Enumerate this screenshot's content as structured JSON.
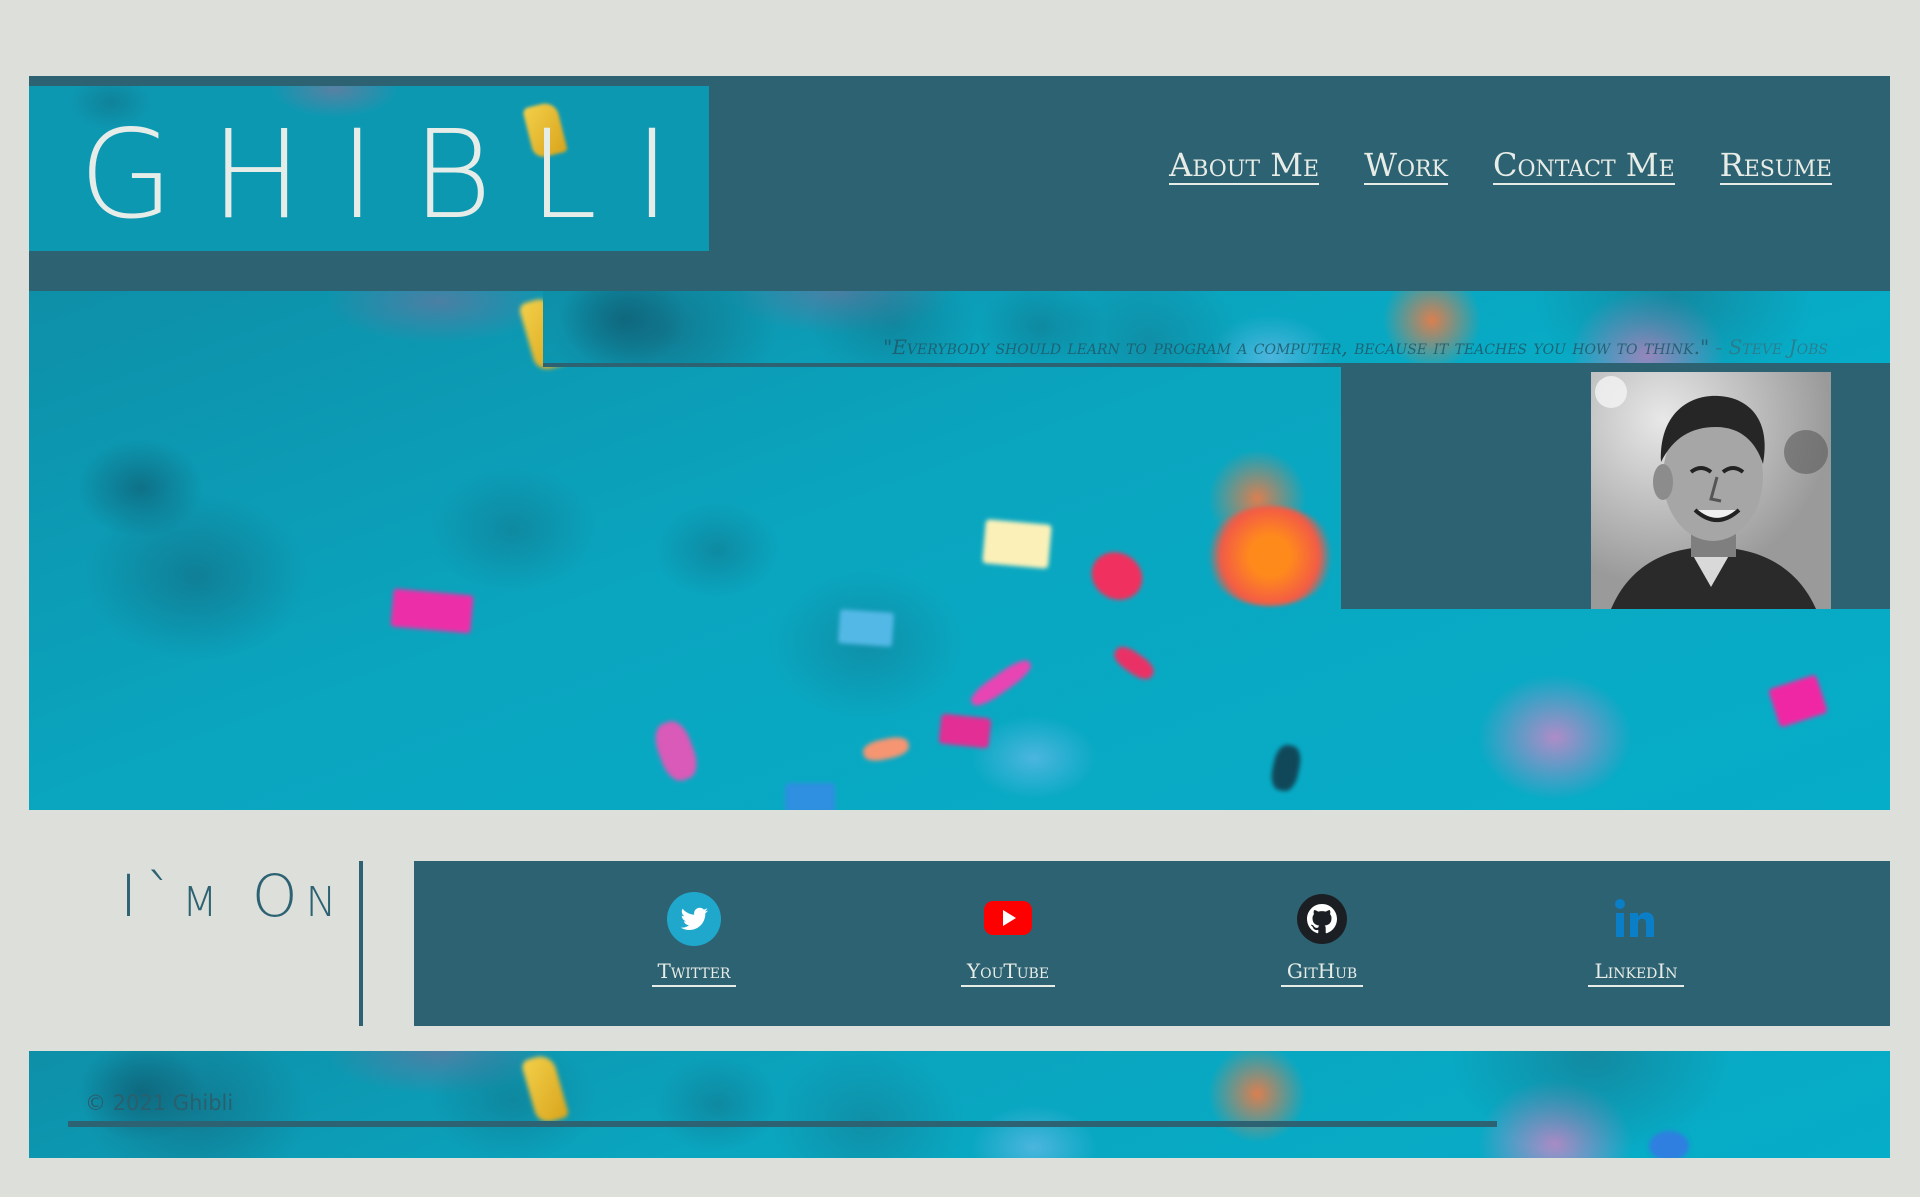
{
  "site": {
    "logo": "GHIBLI"
  },
  "nav": {
    "items": [
      {
        "label": "About Me"
      },
      {
        "label": "Work"
      },
      {
        "label": "Contact Me"
      },
      {
        "label": "Resume"
      }
    ]
  },
  "hero": {
    "quote": "\"Everybody should learn to program a computer, because it teaches you how to think.\"",
    "quote_author": " - Steve Jobs"
  },
  "social": {
    "heading": "I`m On",
    "items": [
      {
        "label": "Twitter",
        "icon": "twitter-icon",
        "color": "#1da1f2"
      },
      {
        "label": "YouTube",
        "icon": "youtube-icon",
        "color": "#ff0000"
      },
      {
        "label": "GitHub",
        "icon": "github-icon",
        "color": "#1b1f23"
      },
      {
        "label": "LinkedIn",
        "icon": "linkedin-icon",
        "color": "#0a66c2"
      }
    ]
  },
  "footer": {
    "copyright": "© 2021 Ghibli"
  },
  "colors": {
    "page_bg": "#dcdfda",
    "panel": "#2d6273",
    "accent_teal": "#0aa2bc",
    "text_light": "#e8ece6"
  }
}
